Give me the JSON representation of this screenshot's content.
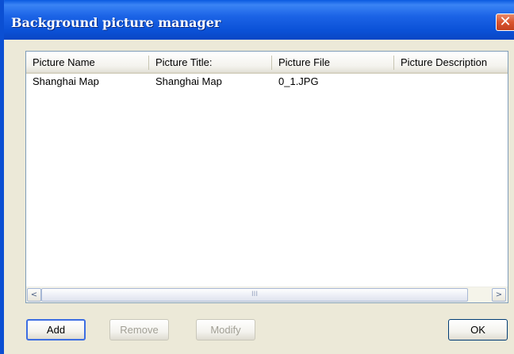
{
  "window": {
    "title": "Background picture manager",
    "close_symbol": "✕"
  },
  "listview": {
    "columns": [
      "Picture Name",
      "Picture Title:",
      "Picture File",
      "Picture Description"
    ],
    "rows": [
      {
        "name": "Shanghai Map",
        "title": "Shanghai Map",
        "file": "0_1.JPG",
        "description": ""
      }
    ]
  },
  "scrollbar": {
    "left_arrow": "<",
    "right_arrow": ">",
    "grip": "III"
  },
  "buttons": {
    "add": "Add",
    "remove": "Remove",
    "modify": "Modify",
    "ok": "OK"
  }
}
